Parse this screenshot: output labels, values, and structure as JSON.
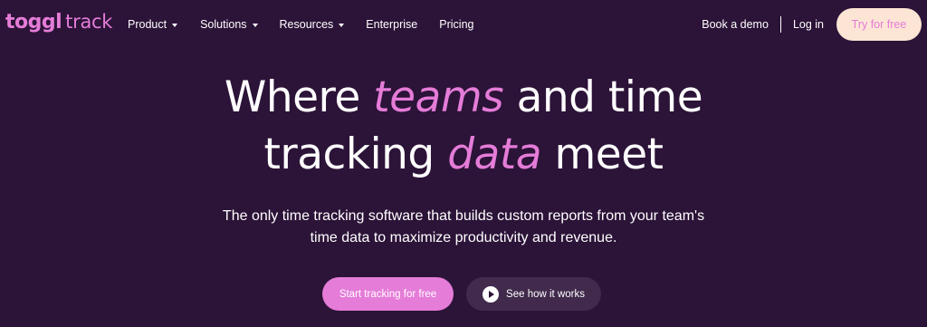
{
  "colors": {
    "background": "#2c1338",
    "accent": "#e57cd8",
    "try_free_bg": "#fde5d5",
    "secondary_button_bg": "#412a4c"
  },
  "logo": {
    "brand": "toggl",
    "product": "track"
  },
  "nav": {
    "items": [
      {
        "label": "Product",
        "icon": "chevron-down-icon"
      },
      {
        "label": "Solutions",
        "icon": "chevron-down-icon"
      },
      {
        "label": "Resources",
        "icon": "chevron-down-icon"
      },
      {
        "label": "Enterprise"
      },
      {
        "label": "Pricing"
      }
    ],
    "book_demo": "Book a demo",
    "login": "Log in",
    "try_free": "Try for free"
  },
  "hero": {
    "title_part1": "Where ",
    "title_accent1": "teams",
    "title_part2": " and time",
    "title_part3": "tracking ",
    "title_accent2": "data",
    "title_part4": " meet",
    "subtitle_line1": "The only time tracking software that builds custom reports from your team's",
    "subtitle_line2": "time data to maximize productivity and revenue.",
    "cta_primary": "Start tracking for free",
    "cta_secondary": "See how it works",
    "cta_secondary_icon": "play-icon"
  }
}
